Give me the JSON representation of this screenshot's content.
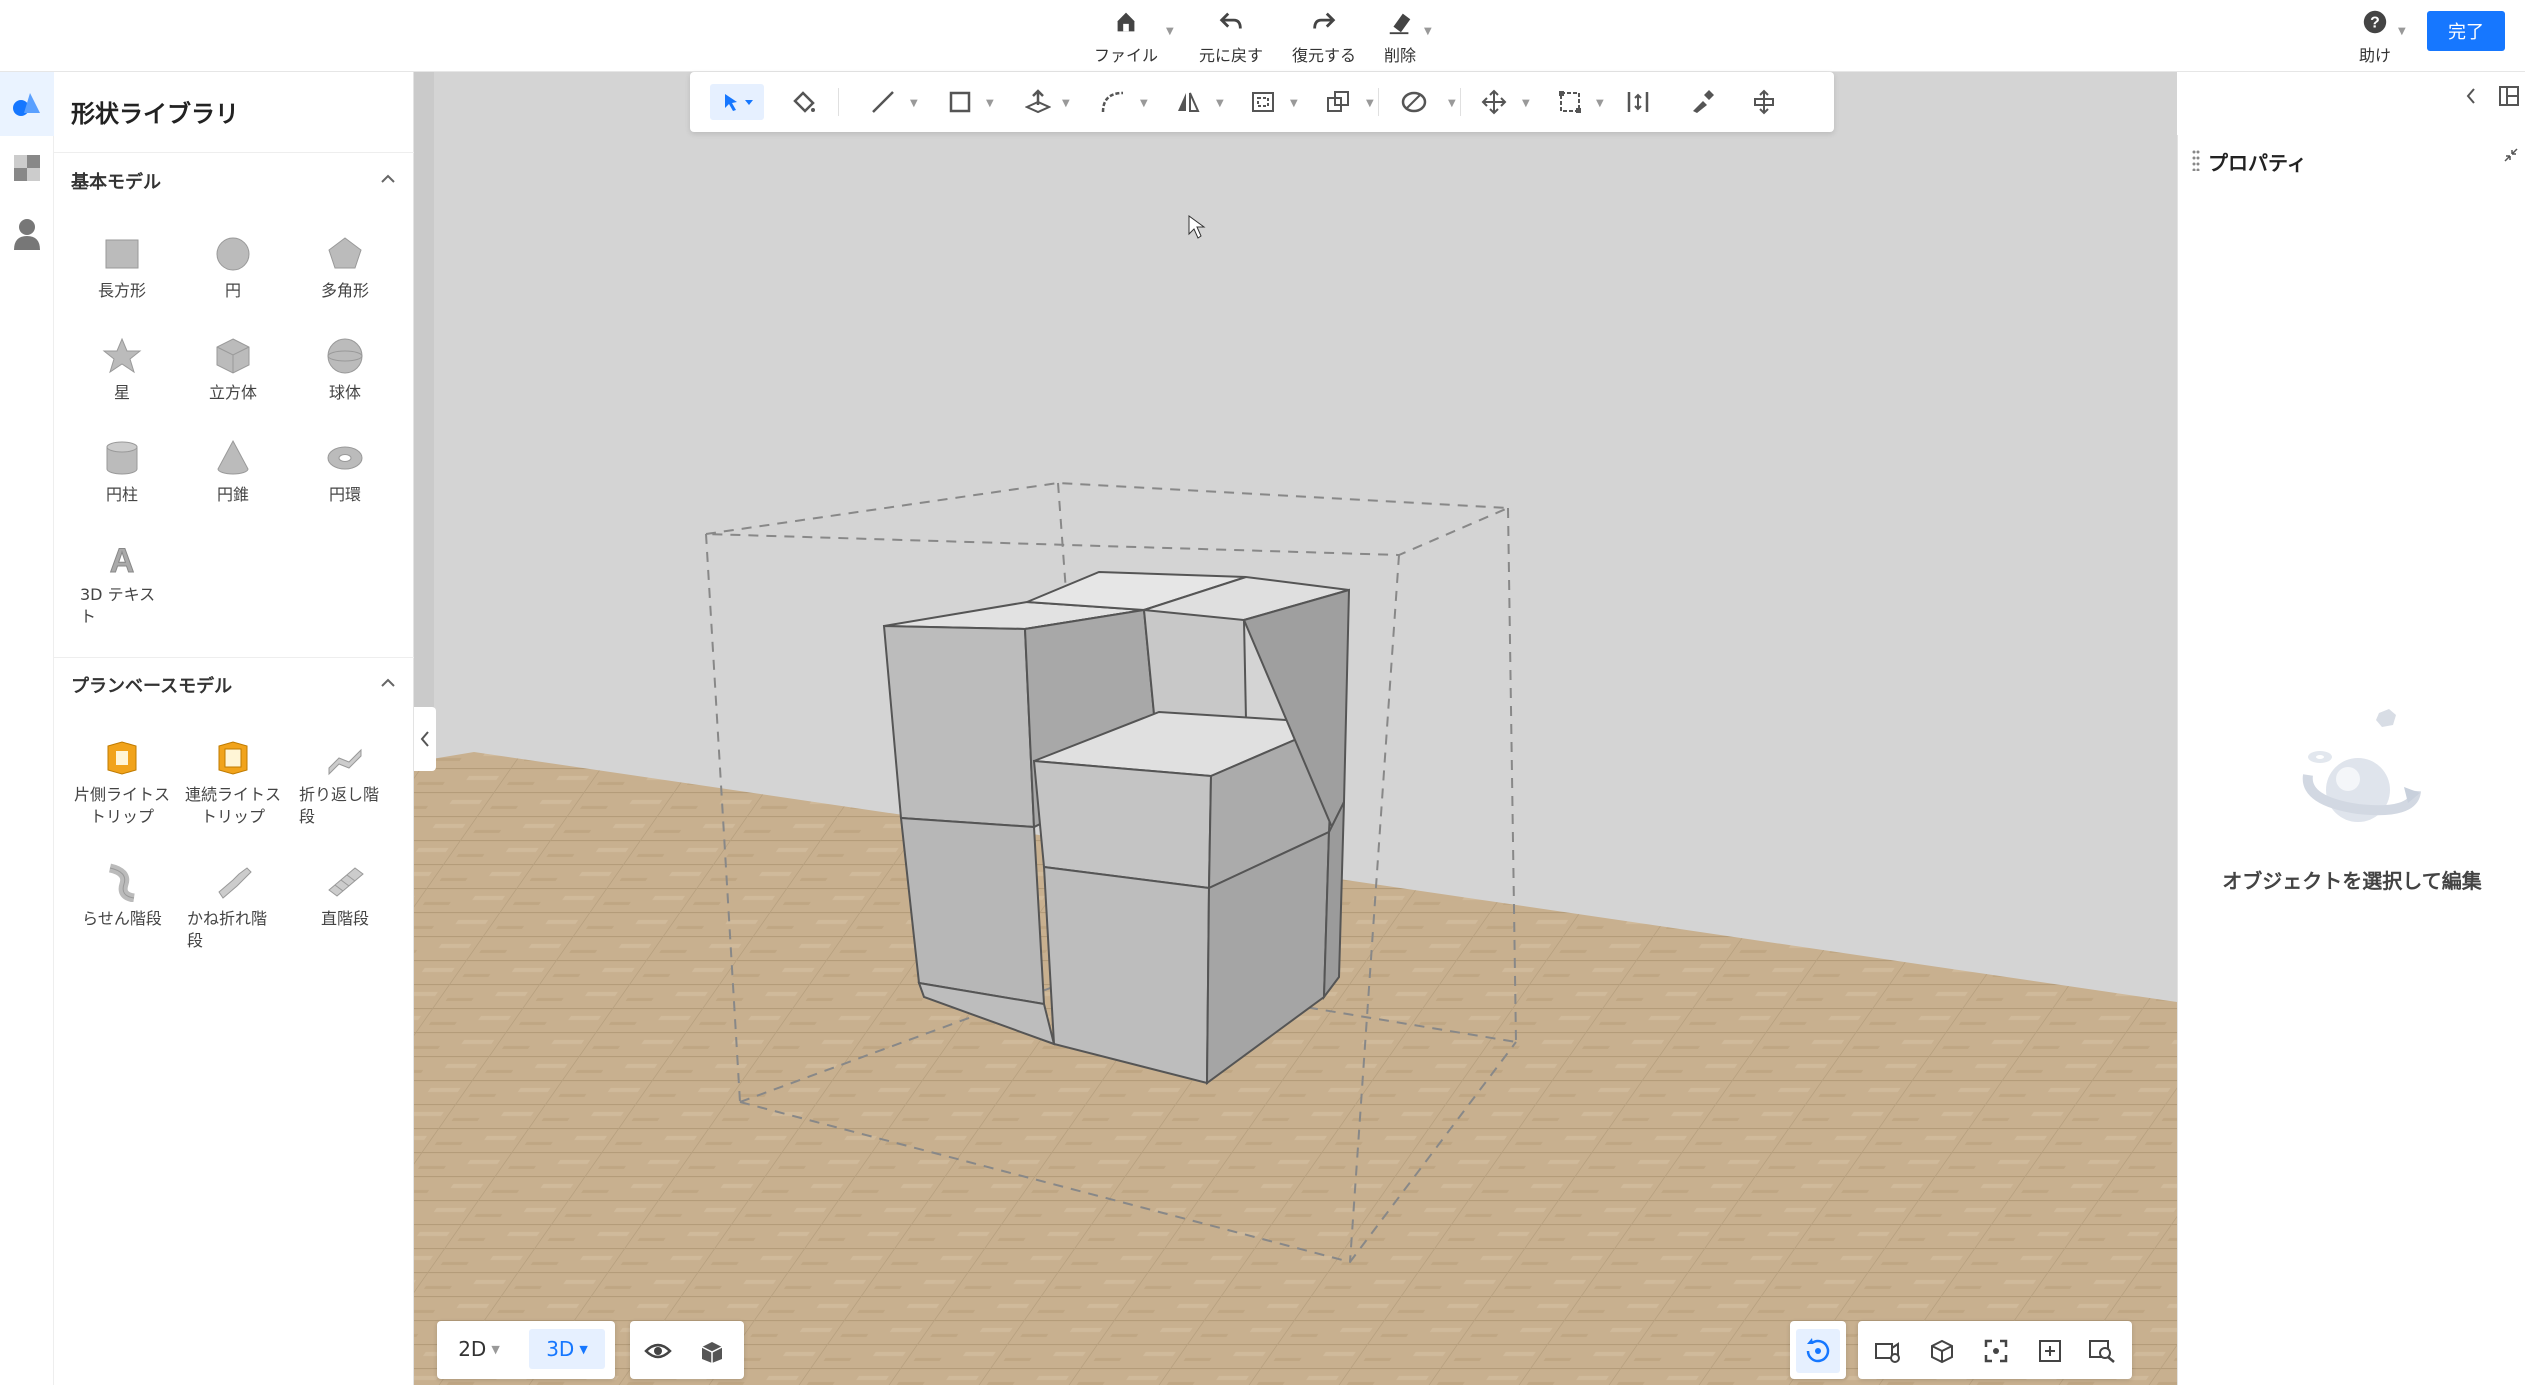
{
  "toolbar": {
    "file_label": "ファイル",
    "undo_label": "元に戻す",
    "redo_label": "復元する",
    "delete_label": "削除",
    "help_label": "助け",
    "done_label": "完了"
  },
  "library": {
    "title": "形状ライブラリ",
    "basic_section": "基本モデル",
    "basic_items": [
      "長方形",
      "円",
      "多角形",
      "星",
      "立方体",
      "球体",
      "円柱",
      "円錐",
      "円環",
      "3D テキスト"
    ],
    "plan_section": "プランベースモデル",
    "plan_items": [
      "片側ライトストリップ",
      "連続ライトストリップ",
      "折り返し階段",
      "らせん階段",
      "かね折れ階段",
      "直階段"
    ]
  },
  "properties": {
    "title": "プロパティ",
    "empty_hint": "オブジェクトを選択して編集"
  },
  "view": {
    "mode_2d": "2D",
    "mode_3d": "3D",
    "active_mode": "3D"
  },
  "colors": {
    "accent": "#1677ff",
    "accent_bg": "#e6f0ff",
    "floor": "#c8b08f",
    "wall": "#d6d6d6"
  }
}
